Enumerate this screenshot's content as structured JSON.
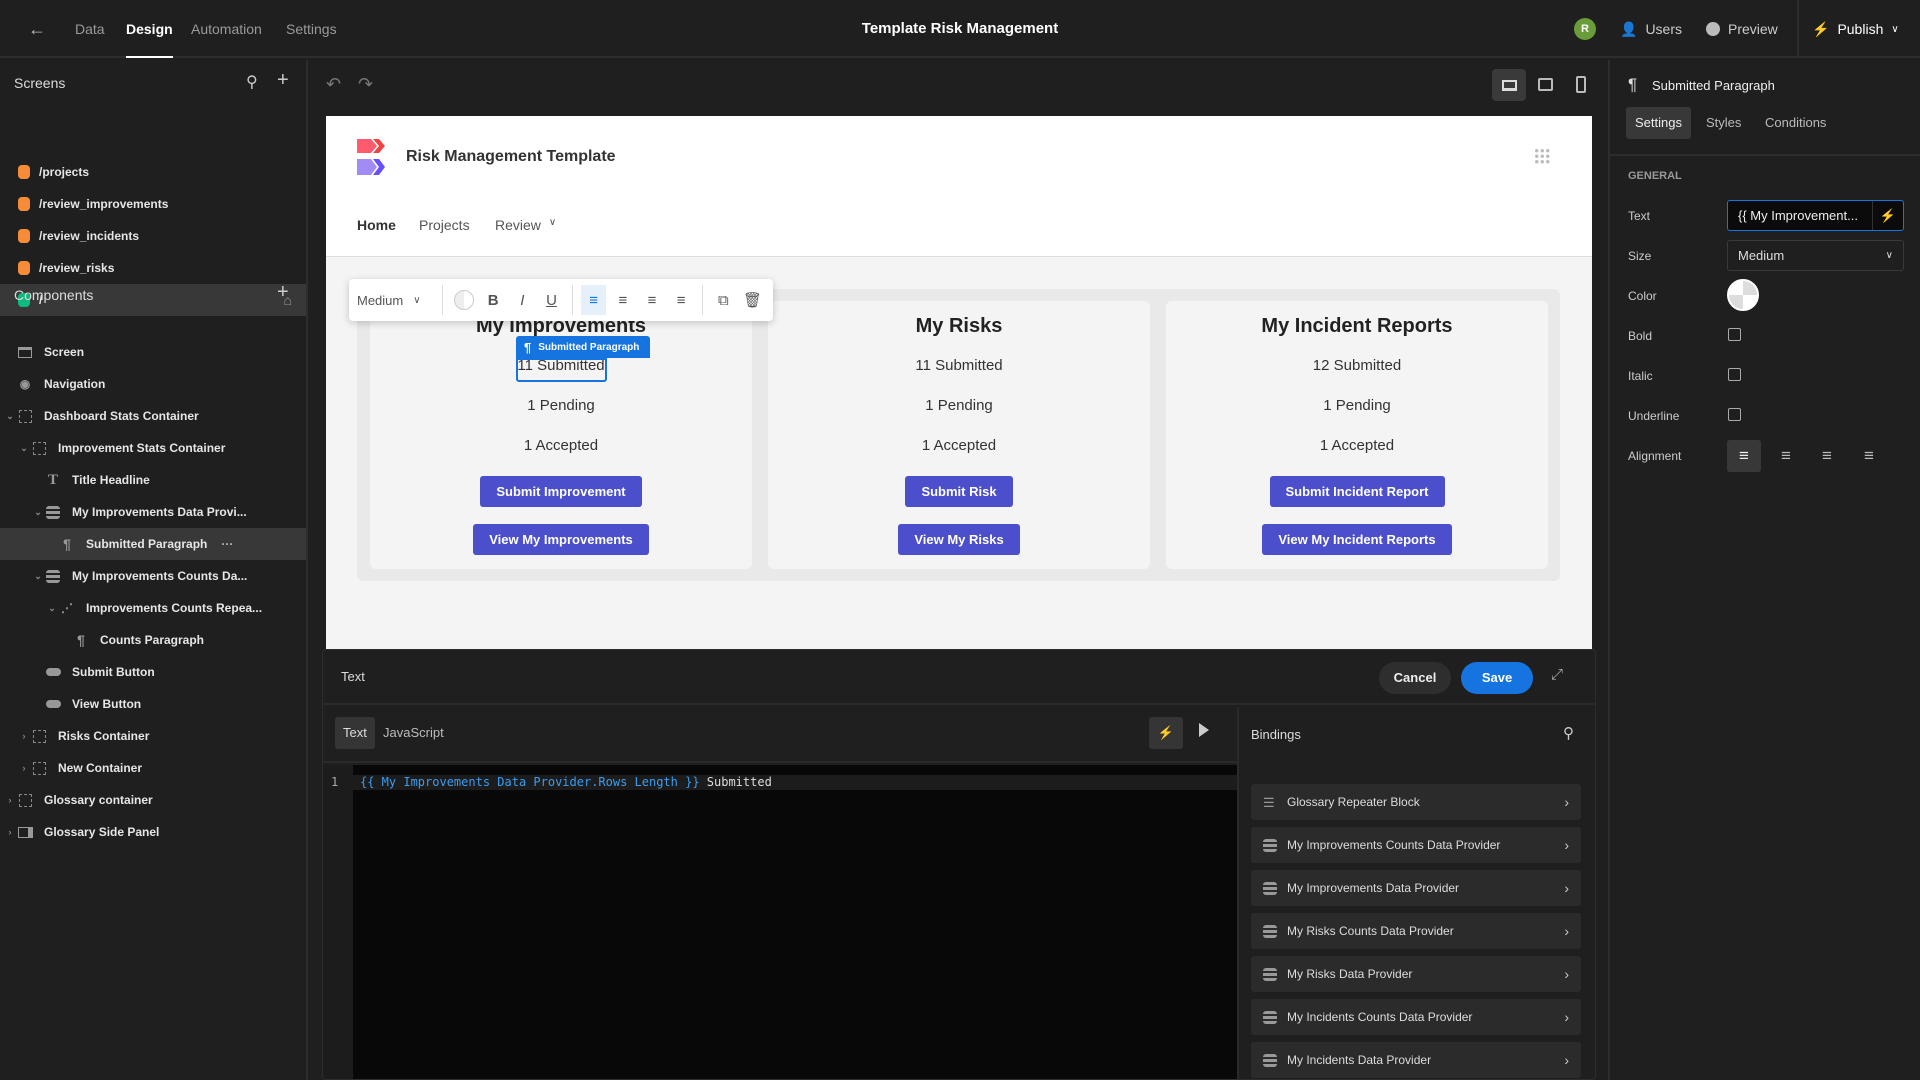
{
  "topbar": {
    "tabs": [
      {
        "label": "Data"
      },
      {
        "label": "Design"
      },
      {
        "label": "Automation"
      },
      {
        "label": "Settings"
      }
    ],
    "title": "Template Risk Management",
    "avatar_initial": "R",
    "users_label": "Users",
    "preview_label": "Preview",
    "publish_label": "Publish"
  },
  "sidebar": {
    "screens_label": "Screens",
    "screens": [
      {
        "label": "/projects",
        "color": "#f68b3a"
      },
      {
        "label": "/review_improvements",
        "color": "#f68b3a"
      },
      {
        "label": "/review_incidents",
        "color": "#f68b3a"
      },
      {
        "label": "/review_risks",
        "color": "#f68b3a"
      },
      {
        "label": "/",
        "color": "#10b981"
      }
    ],
    "components_label": "Components",
    "components": [
      {
        "label": "Screen",
        "icon": "screen-icon"
      },
      {
        "label": "Navigation",
        "icon": "eye-icon"
      },
      {
        "label": "Dashboard Stats Container",
        "icon": "container-icon"
      },
      {
        "label": "Improvement Stats Container",
        "icon": "container-icon"
      },
      {
        "label": "Title Headline",
        "icon": "headline-icon"
      },
      {
        "label": "My Improvements Data Provi...",
        "icon": "database-icon"
      },
      {
        "label": "Submitted Paragraph",
        "icon": "paragraph-icon"
      },
      {
        "label": "My Improvements Counts Da...",
        "icon": "database-icon"
      },
      {
        "label": "Improvements Counts Repea...",
        "icon": "repeater-icon"
      },
      {
        "label": "Counts Paragraph",
        "icon": "paragraph-icon"
      },
      {
        "label": "Submit Button",
        "icon": "button-icon"
      },
      {
        "label": "View Button",
        "icon": "button-icon"
      },
      {
        "label": "Risks Container",
        "icon": "container-icon"
      },
      {
        "label": "New Container",
        "icon": "container-icon"
      },
      {
        "label": "Glossary container",
        "icon": "container-icon"
      },
      {
        "label": "Glossary Side Panel",
        "icon": "side-panel-icon"
      }
    ]
  },
  "preview": {
    "app_name": "Risk Management Template",
    "nav": [
      {
        "label": "Home"
      },
      {
        "label": "Projects"
      },
      {
        "label": "Review"
      }
    ],
    "cards": [
      {
        "title": "My Improvements",
        "submitted": "11 Submitted",
        "pending": "1 Pending",
        "accepted": "1 Accepted",
        "submit_label": "Submit Improvement",
        "view_label": "View My Improvements"
      },
      {
        "title": "My Risks",
        "submitted": "11 Submitted",
        "pending": "1 Pending",
        "accepted": "1 Accepted",
        "submit_label": "Submit Risk",
        "view_label": "View My Risks"
      },
      {
        "title": "My Incident Reports",
        "submitted": "12 Submitted",
        "pending": "1 Pending",
        "accepted": "1 Accepted",
        "submit_label": "Submit Incident Report",
        "view_label": "View My Incident Reports"
      }
    ],
    "selection_label": "Submitted Paragraph",
    "toolbar_size": "Medium",
    "accent": "#4b4fcc"
  },
  "editor": {
    "title": "Text",
    "cancel_label": "Cancel",
    "save_label": "Save",
    "tabs": [
      {
        "label": "Text"
      },
      {
        "label": "JavaScript"
      }
    ],
    "line_number": "1",
    "code_binding": "{{ My Improvements Data Provider.Rows Length }}",
    "code_text": " Submitted",
    "bindings_label": "Bindings",
    "bindings": [
      {
        "label": "Glossary Repeater Block",
        "icon": "list-icon"
      },
      {
        "label": "My Improvements Counts Data Provider",
        "icon": "database-icon"
      },
      {
        "label": "My Improvements Data Provider",
        "icon": "database-icon"
      },
      {
        "label": "My Risks Counts Data Provider",
        "icon": "database-icon"
      },
      {
        "label": "My Risks Data Provider",
        "icon": "database-icon"
      },
      {
        "label": "My Incidents Counts Data Provider",
        "icon": "database-icon"
      },
      {
        "label": "My Incidents Data Provider",
        "icon": "database-icon"
      }
    ]
  },
  "panel": {
    "title": "Submitted Paragraph",
    "tabs": [
      {
        "label": "Settings"
      },
      {
        "label": "Styles"
      },
      {
        "label": "Conditions"
      }
    ],
    "section": "GENERAL",
    "text_label": "Text",
    "text_value": "{{ My Improvement...",
    "size_label": "Size",
    "size_value": "Medium",
    "color_label": "Color",
    "bold_label": "Bold",
    "bold": false,
    "italic_label": "Italic",
    "italic": false,
    "underline_label": "Underline",
    "underline": false,
    "alignment_label": "Alignment",
    "alignment": "left"
  }
}
